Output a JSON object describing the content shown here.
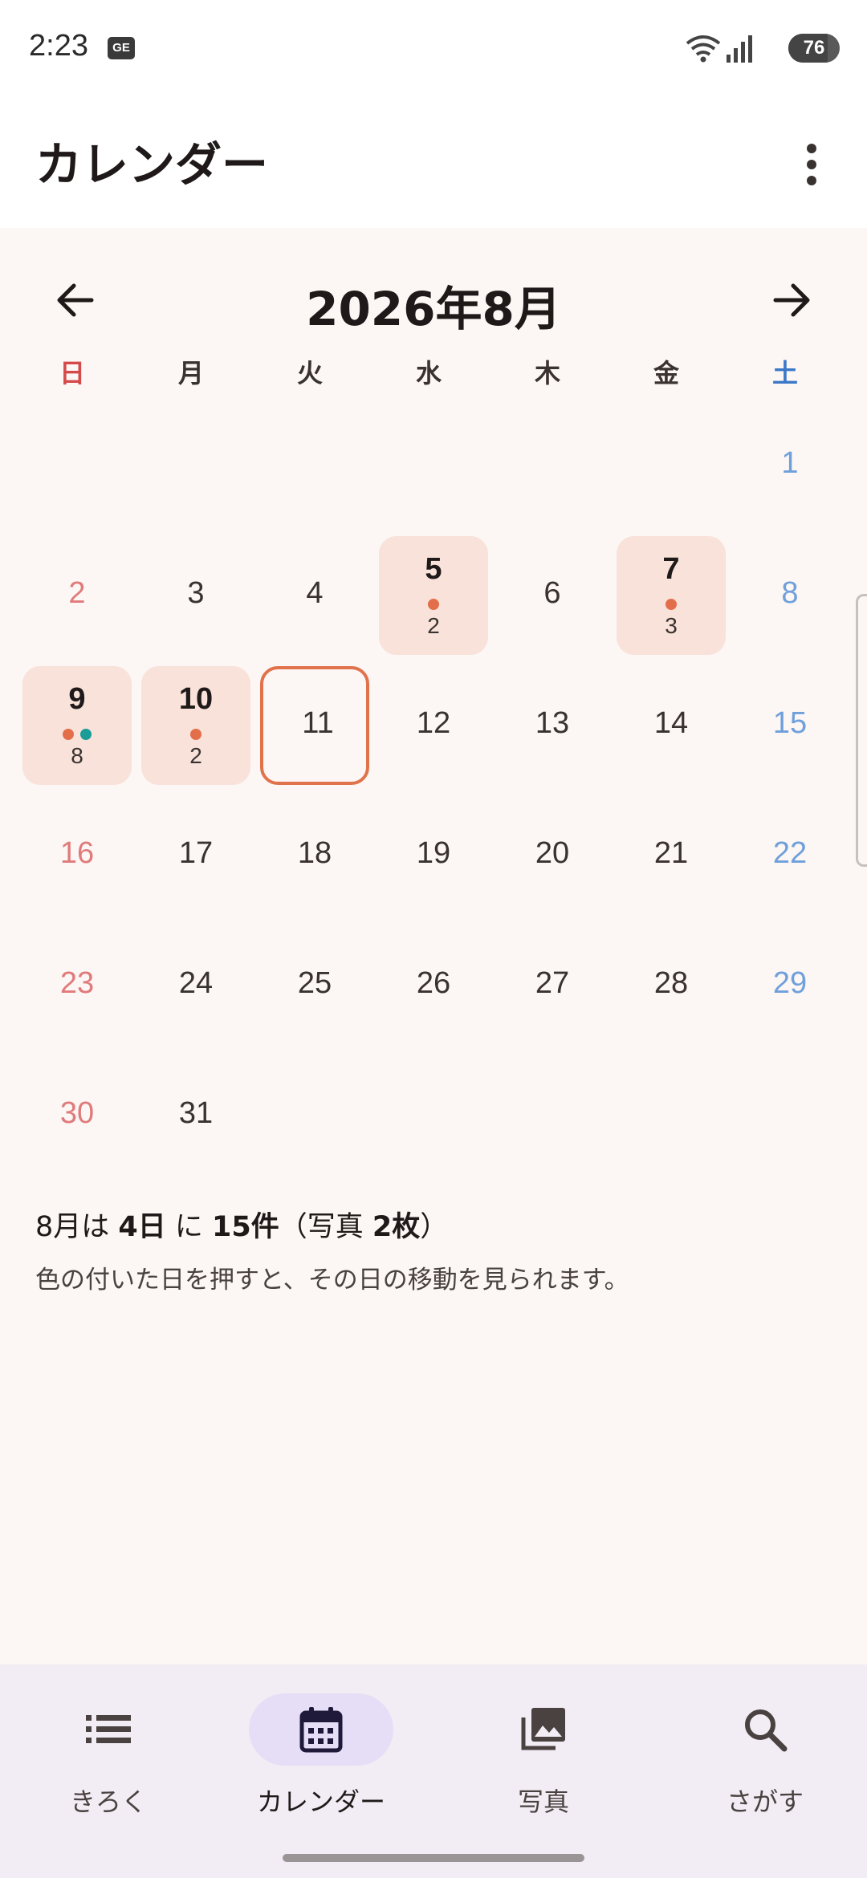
{
  "status_bar": {
    "time": "2:23",
    "carrier_badge": "GE",
    "battery": "76",
    "battery_fraction": 0.76
  },
  "app_bar": {
    "title": "カレンダー",
    "more_icon": "more-vert-icon"
  },
  "calendar": {
    "month_title": "2026年8月",
    "prev_icon": "arrow-left-icon",
    "next_icon": "arrow-right-icon",
    "weekdays": [
      "日",
      "月",
      "火",
      "水",
      "木",
      "金",
      "土"
    ],
    "first_weekday_index": 6,
    "days_in_month": 31,
    "today": 11,
    "day_data": {
      "5": {
        "dots": [
          "#e36f4a"
        ],
        "count": "2"
      },
      "7": {
        "dots": [
          "#e36f4a"
        ],
        "count": "3"
      },
      "9": {
        "dots": [
          "#e36f4a",
          "#1a9c97"
        ],
        "count": "8"
      },
      "10": {
        "dots": [
          "#e36f4a"
        ],
        "count": "2"
      }
    },
    "colors": {
      "highlight_bg": "#f8e2d9",
      "today_border": "#e0734c",
      "sunday": "#e07b7b",
      "saturday": "#6fa0dc"
    }
  },
  "summary": {
    "part1": "8月は ",
    "days_count": "4日",
    "part2": " に ",
    "items_count": "15件",
    "part3": "（写真 ",
    "photos_count": "2枚",
    "part4": "）",
    "hint": "色の付いた日を押すと、その日の移動を見られます。"
  },
  "bottom_nav": {
    "items": [
      {
        "label": "きろく",
        "icon": "list-icon",
        "active": false
      },
      {
        "label": "カレンダー",
        "icon": "calendar-icon",
        "active": true
      },
      {
        "label": "写真",
        "icon": "photo-library-icon",
        "active": false
      },
      {
        "label": "さがす",
        "icon": "search-icon",
        "active": false
      }
    ],
    "active_bg": "#e6def6"
  }
}
